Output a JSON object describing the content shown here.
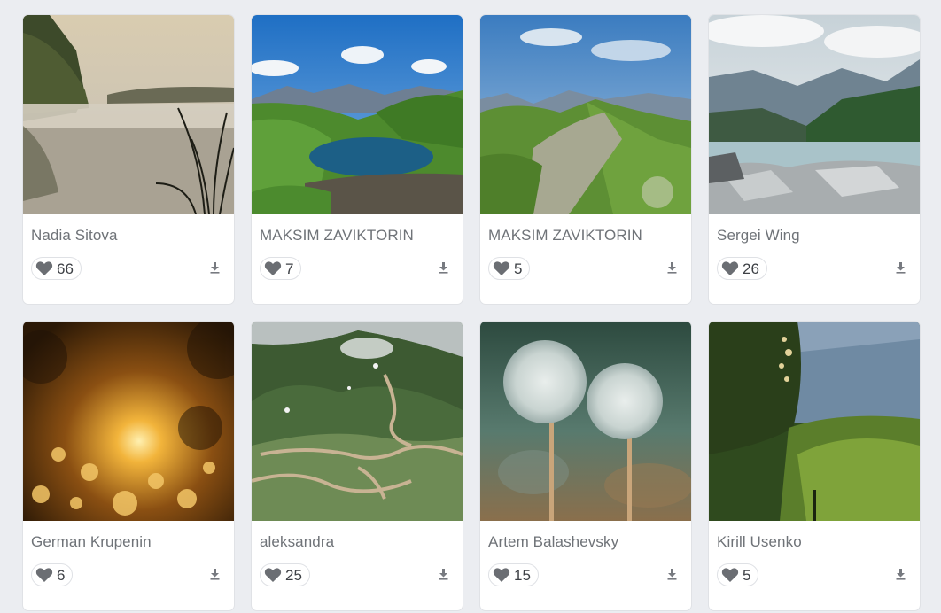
{
  "gallery": {
    "cards": [
      {
        "author": "Nadia Sitova",
        "likes": "66",
        "photo": "misty-river-photo"
      },
      {
        "author": "MAKSIM ZAVIKTORIN",
        "likes": "7",
        "photo": "mountain-lake-photo"
      },
      {
        "author": "MAKSIM ZAVIKTORIN",
        "likes": "5",
        "photo": "green-ridge-photo"
      },
      {
        "author": "Sergei Wing",
        "likes": "26",
        "photo": "river-rocks-photo"
      },
      {
        "author": "German Krupenin",
        "likes": "6",
        "photo": "sunset-dandelions-photo"
      },
      {
        "author": "aleksandra",
        "likes": "25",
        "photo": "mountain-roads-photo"
      },
      {
        "author": "Artem Balashevsky",
        "likes": "15",
        "photo": "dandelion-pair-photo"
      },
      {
        "author": "Kirill Usenko",
        "likes": "5",
        "photo": "forest-lake-photo"
      }
    ],
    "icons": {
      "like": "heart-icon",
      "download": "download-icon"
    }
  },
  "colors": {
    "page_background": "#ebedf1",
    "card_background": "#ffffff",
    "author_text": "#6f7378",
    "heart": "#6b6e73"
  }
}
